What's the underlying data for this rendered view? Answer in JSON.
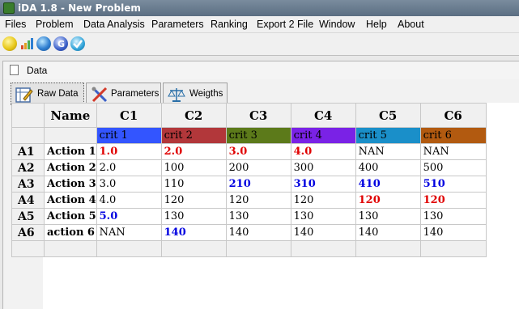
{
  "window": {
    "title": "iDA 1.8 - New Problem"
  },
  "menu": [
    "Files",
    "Problem",
    "Data Analysis",
    "Parameters",
    "Ranking",
    "Export 2 File",
    "Window",
    "Help",
    "About"
  ],
  "toolbar": {
    "buttons": [
      {
        "name": "lightbulb-icon",
        "color": "#e8c81a"
      },
      {
        "name": "bar-chart-icon",
        "color": "#d94b2b"
      },
      {
        "name": "globe-icon",
        "color": "#2f7fd1"
      },
      {
        "name": "refresh-icon",
        "color": "#3a5fc8"
      },
      {
        "name": "check-icon",
        "color": "#2fa3d9"
      }
    ]
  },
  "frame": {
    "title": "Data"
  },
  "tabs": [
    {
      "label": "Raw Data",
      "icon": "edit-table-icon",
      "active": true
    },
    {
      "label": "Parameters",
      "icon": "tools-icon",
      "active": false
    },
    {
      "label": "Weigths",
      "icon": "scales-icon",
      "active": false
    }
  ],
  "grid": {
    "name_header": "Name",
    "columns": [
      {
        "header": "C1",
        "crit": "crit  1",
        "color": "#3355ff"
      },
      {
        "header": "C2",
        "crit": "crit  2",
        "color": "#b2373a"
      },
      {
        "header": "C3",
        "crit": "crit 3",
        "color": "#5c7a1a"
      },
      {
        "header": "C4",
        "crit": "crit 4",
        "color": "#7a22e6"
      },
      {
        "header": "C5",
        "crit": "crit 5",
        "color": "#1a8fc9"
      },
      {
        "header": "C6",
        "crit": "crit 6",
        "color": "#b25a10"
      }
    ],
    "rows": [
      {
        "id": "A1",
        "name": "Action 1",
        "cells": [
          {
            "v": "1.0",
            "s": "red"
          },
          {
            "v": "2.0",
            "s": "red"
          },
          {
            "v": "3.0",
            "s": "red"
          },
          {
            "v": "4.0",
            "s": "red"
          },
          {
            "v": "NAN",
            "s": ""
          },
          {
            "v": "NAN",
            "s": ""
          }
        ]
      },
      {
        "id": "A2",
        "name": "Action 2",
        "cells": [
          {
            "v": "2.0",
            "s": ""
          },
          {
            "v": "100",
            "s": ""
          },
          {
            "v": "200",
            "s": ""
          },
          {
            "v": "300",
            "s": ""
          },
          {
            "v": "400",
            "s": ""
          },
          {
            "v": "500",
            "s": ""
          }
        ]
      },
      {
        "id": "A3",
        "name": "Action 3",
        "cells": [
          {
            "v": "3.0",
            "s": ""
          },
          {
            "v": "110",
            "s": ""
          },
          {
            "v": "210",
            "s": "blue"
          },
          {
            "v": "310",
            "s": "blue"
          },
          {
            "v": "410",
            "s": "blue"
          },
          {
            "v": "510",
            "s": "blue"
          }
        ]
      },
      {
        "id": "A4",
        "name": "Action 4",
        "cells": [
          {
            "v": "4.0",
            "s": ""
          },
          {
            "v": "120",
            "s": ""
          },
          {
            "v": "120",
            "s": ""
          },
          {
            "v": "120",
            "s": ""
          },
          {
            "v": "120",
            "s": "red"
          },
          {
            "v": "120",
            "s": "red"
          }
        ]
      },
      {
        "id": "A5",
        "name": "Action 5",
        "cells": [
          {
            "v": "5.0",
            "s": "blue"
          },
          {
            "v": "130",
            "s": ""
          },
          {
            "v": "130",
            "s": ""
          },
          {
            "v": "130",
            "s": ""
          },
          {
            "v": "130",
            "s": ""
          },
          {
            "v": "130",
            "s": ""
          }
        ]
      },
      {
        "id": "A6",
        "name": "action 6",
        "cells": [
          {
            "v": "NAN",
            "s": ""
          },
          {
            "v": "140",
            "s": "blue"
          },
          {
            "v": "140",
            "s": ""
          },
          {
            "v": "140",
            "s": ""
          },
          {
            "v": "140",
            "s": ""
          },
          {
            "v": "140",
            "s": ""
          }
        ]
      }
    ]
  }
}
